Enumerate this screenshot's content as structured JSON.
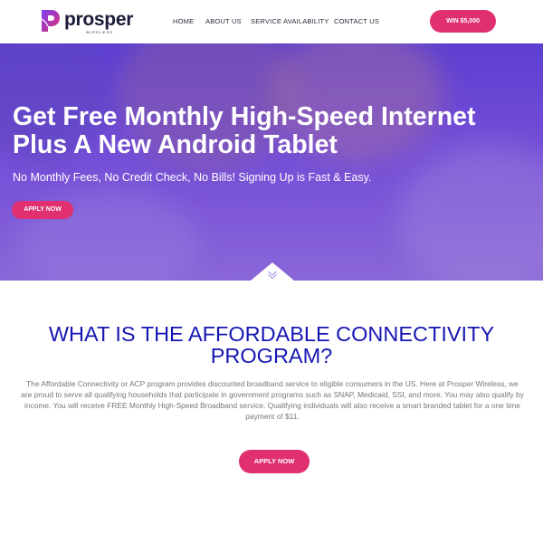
{
  "brand": {
    "name": "prosper",
    "tagline": "WIRELESS",
    "accent": "#e0306f",
    "heading_color": "#1616b4"
  },
  "nav": {
    "items": [
      "HOME",
      "ABOUT US",
      "SERVICE AVAILABILITY",
      "CONTACT US"
    ]
  },
  "header": {
    "cta_label": "WIN $5,000"
  },
  "hero": {
    "title": "Get Free Monthly High-Speed Internet Plus A New Android Tablet",
    "subtitle": "No Monthly Fees, No Credit Check, No Bills! Signing Up is Fast & Easy.",
    "cta_label": "APPLY NOW",
    "scroll_icon": "double-chevron-down-icon"
  },
  "acp": {
    "title": "WHAT IS THE AFFORDABLE CONNECTIVITY PROGRAM?",
    "body": "The Affordable Connectivity or ACP program provides discounted broadband service to eligible consumers in the US. Here at Prosper Wireless, we are proud to serve all qualifying households that participate in government programs such as SNAP, Medicaid, SSI, and more. You may also qualify by income. You will receive FREE Monthly High-Speed Broadband service. Qualifying individuals will also receive a smart branded tablet for a one time payment of $11.",
    "cta_label": "APPLY NOW"
  }
}
